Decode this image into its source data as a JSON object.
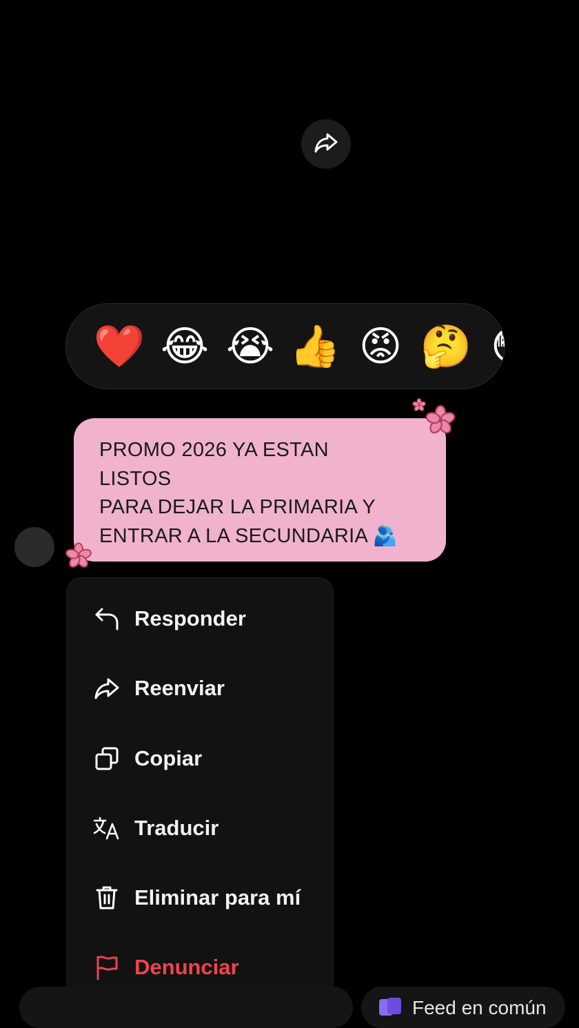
{
  "reactions": {
    "items": [
      {
        "name": "heart",
        "glyph": "❤️"
      },
      {
        "name": "laughing-tears",
        "glyph": "😂"
      },
      {
        "name": "crying",
        "glyph": "😭"
      },
      {
        "name": "thumbs-up",
        "glyph": "👍"
      },
      {
        "name": "angry",
        "glyph": "😡"
      },
      {
        "name": "thinking",
        "glyph": "🤔"
      },
      {
        "name": "surprised",
        "glyph": "😳"
      }
    ]
  },
  "message": {
    "lines": [
      "PROMO 2026 YA ESTAN",
      "LISTOS",
      "PARA DEJAR LA PRIMARIA Y",
      "ENTRAR A LA SECUNDARIA 🫂"
    ],
    "bubble_color": "#f0b2cc",
    "decoration_color": "#c8426f"
  },
  "menu": {
    "items": [
      {
        "label": "Responder",
        "icon": "reply-icon"
      },
      {
        "label": "Reenviar",
        "icon": "forward-icon"
      },
      {
        "label": "Copiar",
        "icon": "copy-icon"
      },
      {
        "label": "Traducir",
        "icon": "translate-icon"
      },
      {
        "label": "Eliminar para mí",
        "icon": "trash-icon"
      },
      {
        "label": "Denunciar",
        "icon": "flag-icon",
        "danger": true
      }
    ],
    "danger_color": "#f0434e"
  },
  "bottom_bar": {
    "feed_label": "Feed en común"
  }
}
